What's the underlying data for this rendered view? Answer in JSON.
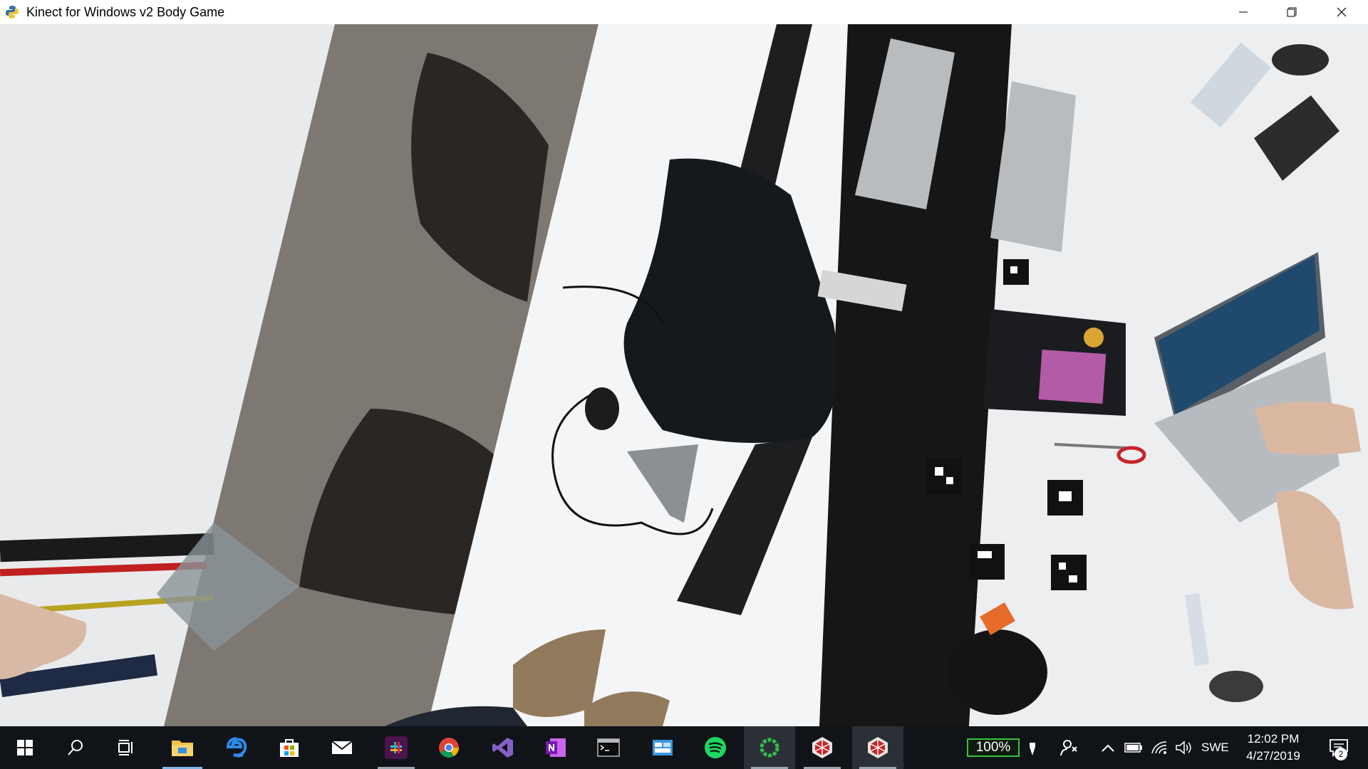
{
  "window": {
    "title": "Kinect for Windows v2 Body Game",
    "icon": "python-icon",
    "controls": [
      "minimize-icon",
      "restore-icon",
      "close-icon"
    ]
  },
  "taskbar": {
    "pinned": [
      {
        "name": "start",
        "icon": "windows-logo-icon"
      },
      {
        "name": "search",
        "icon": "search-icon"
      },
      {
        "name": "task-view",
        "icon": "task-view-icon"
      },
      {
        "name": "file-explorer",
        "icon": "folder-icon"
      },
      {
        "name": "edge",
        "icon": "edge-icon"
      },
      {
        "name": "store",
        "icon": "store-icon"
      },
      {
        "name": "mail",
        "icon": "mail-icon"
      },
      {
        "name": "slack",
        "icon": "slack-icon"
      },
      {
        "name": "chrome",
        "icon": "chrome-icon"
      },
      {
        "name": "visual-studio",
        "icon": "visual-studio-icon"
      },
      {
        "name": "onenote",
        "icon": "onenote-icon"
      },
      {
        "name": "terminal",
        "icon": "terminal-icon"
      },
      {
        "name": "control-panel",
        "icon": "control-panel-icon"
      },
      {
        "name": "spotify",
        "icon": "spotify-icon"
      },
      {
        "name": "circle-app",
        "icon": "green-ring-icon"
      },
      {
        "name": "kinect-app-1",
        "icon": "kinect-icon"
      },
      {
        "name": "kinect-app-2",
        "icon": "kinect-icon"
      }
    ],
    "tray": {
      "battery_percent": "100%",
      "language": "SWE",
      "time": "12:02 PM",
      "date": "4/27/2019",
      "notification_count": "2"
    }
  },
  "colors": {
    "taskbar_bg": "#101419",
    "active_indicator": "#7fb6e6",
    "battery_green": "#36c23a"
  }
}
